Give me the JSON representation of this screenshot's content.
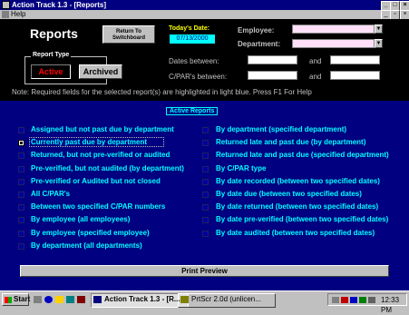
{
  "window": {
    "title": "Action Track 1.3 - [Reports]"
  },
  "menu": {
    "help": "Help"
  },
  "header": {
    "title": "Reports",
    "return_button": "Return To Switchboard",
    "todays_date_label": "Today's Date:",
    "todays_date_value": "07/13/2000",
    "employee_label": "Employee:",
    "department_label": "Department:",
    "report_type_label": "Report Type",
    "active_button": "Active",
    "archived_button": "Archived",
    "dates_between_label": "Dates between:",
    "cpars_between_label": "C/PAR's between:",
    "and1": "and",
    "and2": "and"
  },
  "note": "Note:  Required fields for the selected report(s) are highlighted in light blue.   Press F1 For Help",
  "active_reports_label": "Active Reports",
  "left_options": [
    {
      "label": "Assigned but not past due by department",
      "checked": false
    },
    {
      "label": "Currently past due by department",
      "checked": true
    },
    {
      "label": "Returned, but not pre-verified or audited",
      "checked": false
    },
    {
      "label": "Pre-verified, but not audited (by department)",
      "checked": false
    },
    {
      "label": "Pre-verified or Audited but not closed",
      "checked": false
    },
    {
      "label": "All C/PAR's",
      "checked": false
    },
    {
      "label": "Between two specified C/PAR numbers",
      "checked": false
    },
    {
      "label": "By employee (all employees)",
      "checked": false
    },
    {
      "label": "By employee (specified employee)",
      "checked": false
    },
    {
      "label": "By department (all departments)",
      "checked": false
    }
  ],
  "right_options": [
    {
      "label": "By department (specified department)",
      "checked": false
    },
    {
      "label": "Returned late and past due (by department)",
      "checked": false
    },
    {
      "label": "Returned late and past due (specified department)",
      "checked": false
    },
    {
      "label": "By C/PAR type",
      "checked": false
    },
    {
      "label": "By date recorded (between two specified dates)",
      "checked": false
    },
    {
      "label": "By date due (between two specified dates)",
      "checked": false
    },
    {
      "label": "By date returned (between two specified dates)",
      "checked": false
    },
    {
      "label": "By date pre-verified (between two specified dates)",
      "checked": false
    },
    {
      "label": "By date audited (between two specified dates)",
      "checked": false
    }
  ],
  "print_preview": "Print Preview",
  "taskbar": {
    "start": "Start",
    "task1": "Action Track 1.3 - [R...",
    "task2": "PrtScr 2.0d (unlicen...",
    "clock": "12:33 PM"
  },
  "colors": {
    "accent_cyan": "#00ffff",
    "active_red": "#ff0000",
    "header_black": "#000000",
    "form_navy": "#000080"
  }
}
